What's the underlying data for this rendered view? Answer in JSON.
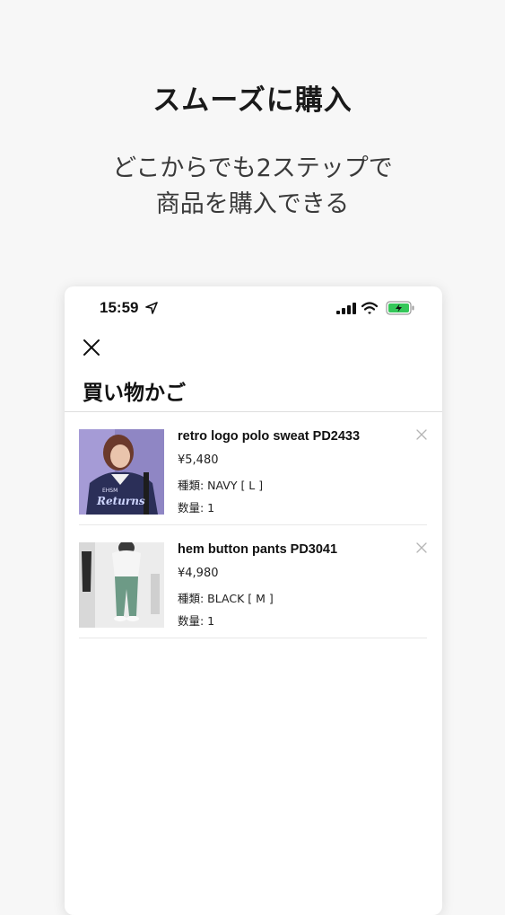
{
  "promo": {
    "title": "スムーズに購入",
    "subtitle_line1": "どこからでも2ステップで",
    "subtitle_line2": "商品を購入できる"
  },
  "status_bar": {
    "time": "15:59",
    "icons": [
      "location-arrow-icon",
      "signal-icon",
      "wifi-icon",
      "battery-charging-icon"
    ],
    "battery_color": "#34c759"
  },
  "cart": {
    "close_icon": "close-icon",
    "title": "買い物かご",
    "items": [
      {
        "name": "retro logo polo sweat PD2433",
        "price": "¥5,480",
        "variant": "種類: NAVY [ L ]",
        "quantity": "数量: 1",
        "remove_icon": "remove-x-icon"
      },
      {
        "name": "hem button pants PD3041",
        "price": "¥4,980",
        "variant": "種類: BLACK [ M ]",
        "quantity": "数量: 1",
        "remove_icon": "remove-x-icon"
      }
    ]
  }
}
